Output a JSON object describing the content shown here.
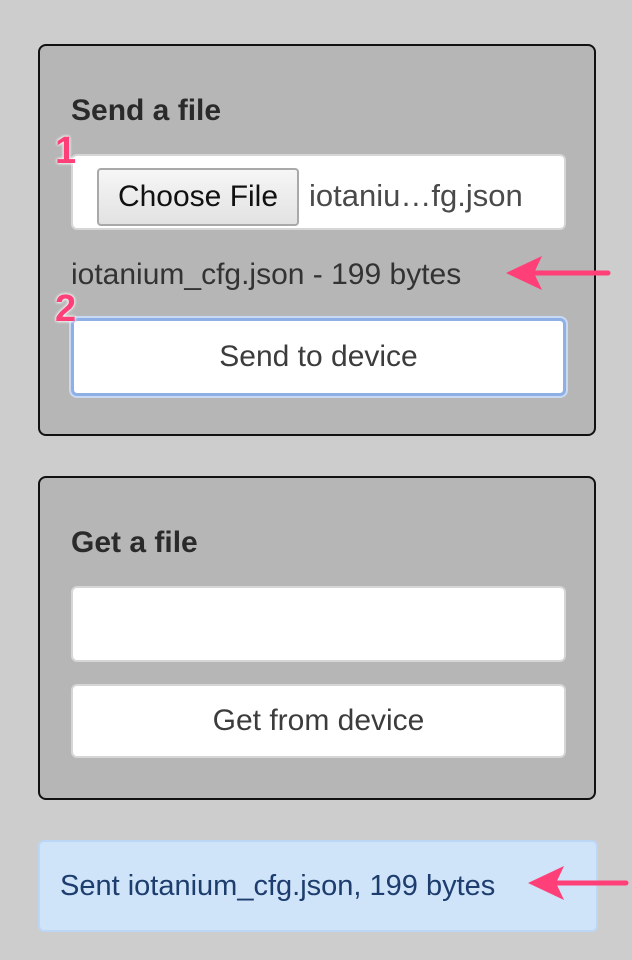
{
  "send_section": {
    "title": "Send a file",
    "choose_file_label": "Choose File",
    "selected_file_display": "iotaniu…fg.json",
    "file_info": "iotanium_cfg.json - 199 bytes",
    "send_button_label": "Send to device"
  },
  "get_section": {
    "title": "Get a file",
    "filename_value": "",
    "get_button_label": "Get from device"
  },
  "status": {
    "message": "Sent iotanium_cfg.json, 199 bytes"
  },
  "annotations": {
    "step1": "1",
    "step2": "2",
    "color": "#ff3f77"
  },
  "colors": {
    "page_bg": "#cdcdcd",
    "panel_bg": "#b6b6b6",
    "alert_bg": "#cfe3f9",
    "alert_text": "#1d3d6e"
  }
}
